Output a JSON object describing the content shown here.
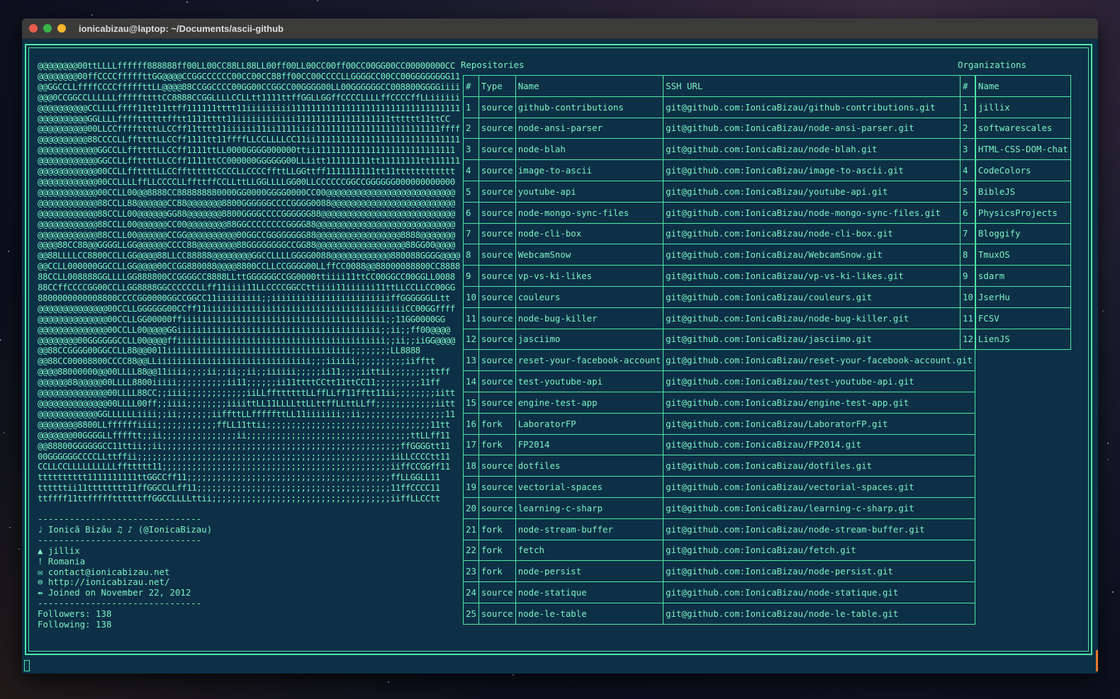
{
  "window": {
    "title": "ionicabizau@laptop: ~/Documents/ascii-github"
  },
  "ascii_art": "@@@@@@@@00ttLLLLffffff888888ff00LL00CC88LL88LL00ff00LL00CC00ff00CC00GG00CC00000000CC\n@@@@@@@@00ffCCCCfffffttGG@@@@CCGGCCCCCC00CC00CC88ff00CC00CCCCLLGGGGCC00CC00GGGGGGGG11\n@@GGCCLLffffCCCCfffffttLL@@@@88CCGGCCCC00GG00CCGGCC00GGGG00LL00GGGGGGCC008800GGGGiiii\n@@@0CCGGCCLLLLLLfffffttttCC8888CCGGLLLLCCLLtt1111ttffGGLLGGffCCCCLLLLffCCCCffLLiiiiii\n@@@@@@@@@@CCLLLLffff11tt11ttff111111tttt11iiiiiiiii1111111111111111111111111111111111\n@@@@@@@@@@GGLLLLffffttttttfftt1111tttt11iiiiiiiiiiii1111111111111111111tttttt11ttCC\n@@@@@@@@@@00LLCCffffttttLLCCff11tttt11iiiiii11ii1111iiii1111111111111111111111111ffff\n@@@@@@@@@@88CCCCLLffttttLLCCff1111tt11ffffLLCCLLLLCC11ii11111111111111111111111111111\n@@@@@@@@@@@@GGCCLLffttttLLCCff1111ttLL0000GGGG000000ttii1111111111111111111111111111\n@@@@@@@@@@@@GGCCLLffttttLLCCff1111ttCC000000GGGGGG00LLiitt111111111tt11111111tt111111\n@@@@@@@@@@@@00CCLLffttttLLCCffttttttCCCCLLCCCCffttLLGGttff1111111111tt11tttttttttttt\n@@@@@@@@@@@@00CCLLLLffLLCCCCLLffttffCCLLttLLGGLLLLGG00LLCCCCCCGGCCGGGGGG000000000000\n@@@@@@@@@@@@00CCLL00@@8888CC888888880000GG0000GGGG0000CC00@@@@@@@@@@@@@@@@@@@@@@@@@@\n@@@@@@@@@@@@88CCLL88@@@@@@CC88@@@@@@@8800GGGGGGCCCCGGGG0088@@@@@@@@@@@@@@@@@@@@@@@@@\n@@@@@@@@@@@@88CCLL00@@@@@@GG88@@@@@@@8800GGGGCCCCGGGGGG88@@@@@@@@@@@@@@@@@@@@@@@@@@@\n@@@@@@@@@@@@88CCLL00@@@@@@CC00@@@@@@@@88GGCCCCCCCCGGGG88@@@@@@@@@@@@@@@@@@@@@@@@@@@@\n@@@@@@@@@@@@88CCLL00@@@@@@CCGG@@@@@@@@@@00GGCCGGGGGGGG88@@@@@@@@@@@@@@@@@8888@@@@@@@\n@@@@88CC88@@GGGGLLGG@@@@@@CCCC88@@@@@@@@88GGGGGGGGCCGG88@@@@@@@@@@@@@@@@@@88GG00@@@@\n@@88LLLLCC8800CCLLGG@@@@88LLCC88888@@@@@@@@GGCCLLLLGGGG0088@@@@@@@@@@@@880088GGGG@@@@\n@@CCLL000000GGCCLLGG@@@@00CCGG880088@@@@8800CCLLCCGGGG00LLffCC0088@@88000088800CC8888\n88CCLL008888GGLLLLGG888800CCGGGGCC8888LLttGGGGGGCCGG0000ttiiii11ttCC00GGCC00GGLL0088\n88CCffCCCCGG00CCLLGG8888GGCCCCCCLLff11iiii11LLCCCCGGCCttiiii11iiiiii11ttLLCCLLCC00GG\n8800000000008800CCCCGG0000GGCCGGCC11iiiiiiiii;;iiiiiiiiiiiiiiiiiiiiiiiiffGGGGGGLLtt\n@@@@@@@@@@@@@@00CCLLGGGGGG00CCff11iiiiiiiiiiiiiiiiiiiiiiiiiiiiiiiiiiiiiiiiCC00GGffff\n@@@@@@@@@@@@@@00CCLLGG00000ffiiiiiiiiiiiiiiiiiiiiiiiiiiiiiiiiiiiiiiiii;;11GG0000GG\n@@@@@@@@@@@@@@00CCLL00@@@@GGiiiiiiiiiiiiiiiiiiiiiiiiiiiiiiiiiiiiiiiii;;ii;;ff00@@@@\n@@@@@@@@00GGGGGGCCLL00@@@@ffiiiiiiiiiiiiiiiiiiiiiiiiiiiiiiiiiiiiiiiiii;;ii;;iiGG@@@@\n@@88CCGGGG00GGCCLL88@@0011iiiiiiiiiiiiiiiiiiiiiiiiiiiiiiiiiiiii;;;;;;;;LL8888\n@@88CC00008800CCCC88@@LLiiiiiiiiiiiiiiiiiiiiiiiiiiiiiii;;;iiiiii;;;;;;;;;;iifftt\n@@@@88000000@@00LLLL88@@11iiii;;;;ii;;ii;;ii;;iiiiii;;;;;ii11;;;;iittii;;;;;;;;ttff\n@@@@@@88@@@@@00LLLL8800iiiii;;;;;;;;;;ii11;;;;;;ii11ttttCCtt11ttCC11;;;;;;;;;11ff\n@@@@@@@@@@@@@@00LLLL88CC;;iiii;;;;;;;;;;;;iiLLffttttttLLffLLff11fftt11ii;;;;;;;;iitt\n@@@@@@@@@@@@@@00LLLL00ff;;iiii;;;;;;;;iiiittLL11LLLLttLLttffLLttLLff;;;;;;;;;;;;iitt\n@@@@@@@@@@@@GGLLLLLLiiii;;ii;;;;;;;iiffttLLfffffttLL11iiiiiii;;ii;;;;;;;;;;;;;;;;;11\n@@@@@@@@8800LLffffffiiii;;;;;;;;;;;;ffLL11ttii;;;;;;;;;;;;;;;;;;;;;;;;;;;;;;;;;11tt\n@@@@@@@00GGGGLLfffftt;;ii;;;;;;;;;;;;;;;ii;;;;;;;;;;;;;;;;;;;;;;;;;;;;;;;;;ttLLff11\n@@88800GGGGGGCC11ttii;;ii;;;;;;;;;;;;;;;;;;;;;;;;;;;;;;;;;;;;;;;;;;;;;;;;ffGGGGtt11\n00GGGGGGCCCCLLttffii;;;;;;;;;;;;;;;;;;;;;;;;;;;;;;;;;;;;;;;;;;;;;;;;;;;iiLLCCCCtt11\nCCLLCCLLLLLLLLLLffttttt11;;;;;;;;;;;;;;;;;;;;;;;;;;;;;;;;;;;;;;;;;;;;;;iiffCCGGff11\ntttttttttt1111111111ttGGCCff11;;;;;;;;;;;;;;;;;;;;;;;;;;;;;;;;;;;;;;;;;ffLLGGLL11\nttttttii11tttttttt11ffGGCCLLff11;;;;;;;;;;;;;;;;;;;;;;;;;;;;;;;;;;;;;;;11ffCCCC11\nttffff11ttfffffttttttffGGCCLLLLttii;;;;;;;;;;;;;;;;;;;;;;;;;;;;;;;;;;;;iiffLLCCtt",
  "profile": {
    "separator": "-------------------------------",
    "name_line": "♩ Ionică Bizău ♫ ♪ (@IonicaBizau)",
    "company": "▲ jillix",
    "location": "! Romania",
    "email": "✉ contact@ionicabizau.net",
    "website": "⊜ http://ionicabizau.net/",
    "joined": "⇴ Joined on November 22, 2012",
    "followers": "Followers: 138",
    "following": "Following: 138"
  },
  "repos": {
    "label": "Repositories",
    "headers": [
      "#",
      "Type",
      "Name",
      "SSH URL"
    ],
    "rows": [
      [
        "1",
        "source",
        "github-contributions",
        "git@github.com:IonicaBizau/github-contributions.git"
      ],
      [
        "2",
        "source",
        "node-ansi-parser",
        "git@github.com:IonicaBizau/node-ansi-parser.git"
      ],
      [
        "3",
        "source",
        "node-blah",
        "git@github.com:IonicaBizau/node-blah.git"
      ],
      [
        "4",
        "source",
        "image-to-ascii",
        "git@github.com:IonicaBizau/image-to-ascii.git"
      ],
      [
        "5",
        "source",
        "youtube-api",
        "git@github.com:IonicaBizau/youtube-api.git"
      ],
      [
        "6",
        "source",
        "node-mongo-sync-files",
        "git@github.com:IonicaBizau/node-mongo-sync-files.git"
      ],
      [
        "7",
        "source",
        "node-cli-box",
        "git@github.com:IonicaBizau/node-cli-box.git"
      ],
      [
        "8",
        "source",
        "WebcamSnow",
        "git@github.com:IonicaBizau/WebcamSnow.git"
      ],
      [
        "9",
        "source",
        "vp-vs-ki-likes",
        "git@github.com:IonicaBizau/vp-vs-ki-likes.git"
      ],
      [
        "10",
        "source",
        "couleurs",
        "git@github.com:IonicaBizau/couleurs.git"
      ],
      [
        "11",
        "source",
        "node-bug-killer",
        "git@github.com:IonicaBizau/node-bug-killer.git"
      ],
      [
        "12",
        "source",
        "jasciimo",
        "git@github.com:IonicaBizau/jasciimo.git"
      ],
      [
        "13",
        "source",
        "reset-your-facebook-account",
        "git@github.com:IonicaBizau/reset-your-facebook-account.git"
      ],
      [
        "14",
        "source",
        "test-youtube-api",
        "git@github.com:IonicaBizau/test-youtube-api.git"
      ],
      [
        "15",
        "source",
        "engine-test-app",
        "git@github.com:IonicaBizau/engine-test-app.git"
      ],
      [
        "16",
        "fork",
        "LaboratorFP",
        "git@github.com:IonicaBizau/LaboratorFP.git"
      ],
      [
        "17",
        "fork",
        "FP2014",
        "git@github.com:IonicaBizau/FP2014.git"
      ],
      [
        "18",
        "source",
        "dotfiles",
        "git@github.com:IonicaBizau/dotfiles.git"
      ],
      [
        "19",
        "source",
        "vectorial-spaces",
        "git@github.com:IonicaBizau/vectorial-spaces.git"
      ],
      [
        "20",
        "source",
        "learning-c-sharp",
        "git@github.com:IonicaBizau/learning-c-sharp.git"
      ],
      [
        "21",
        "fork",
        "node-stream-buffer",
        "git@github.com:IonicaBizau/node-stream-buffer.git"
      ],
      [
        "22",
        "fork",
        "fetch",
        "git@github.com:IonicaBizau/fetch.git"
      ],
      [
        "23",
        "fork",
        "node-persist",
        "git@github.com:IonicaBizau/node-persist.git"
      ],
      [
        "24",
        "source",
        "node-statique",
        "git@github.com:IonicaBizau/node-statique.git"
      ],
      [
        "25",
        "source",
        "node-le-table",
        "git@github.com:IonicaBizau/node-le-table.git"
      ]
    ]
  },
  "orgs": {
    "label": "Organizations",
    "headers": [
      "#",
      "Name"
    ],
    "rows": [
      [
        "1",
        "jillix"
      ],
      [
        "2",
        "softwarescales"
      ],
      [
        "3",
        "HTML-CSS-DOM-chat"
      ],
      [
        "4",
        "CodeColors"
      ],
      [
        "5",
        "BibleJS"
      ],
      [
        "6",
        "PhysicsProjects"
      ],
      [
        "7",
        "Bloggify"
      ],
      [
        "8",
        "TmuxOS"
      ],
      [
        "9",
        "sdarm"
      ],
      [
        "10",
        "JserHu"
      ],
      [
        "11",
        "FCSV"
      ],
      [
        "12",
        "LienJS"
      ]
    ]
  },
  "colors": {
    "terminal_bg": "#0d3046",
    "text": "#7cf2c5",
    "border": "#4ee6a6"
  }
}
